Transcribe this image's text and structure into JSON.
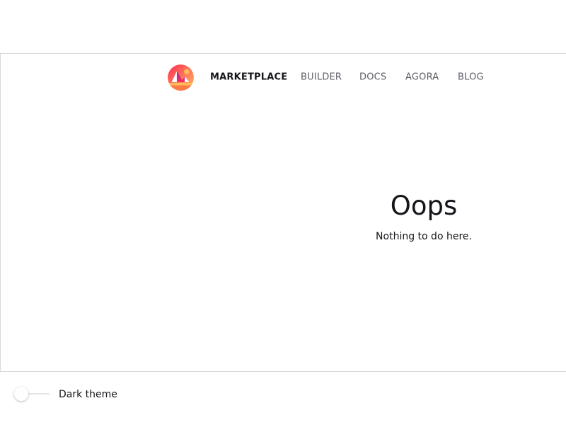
{
  "header": {
    "logo_icon": "decentraland-logo-icon",
    "nav": {
      "marketplace": "MARKETPLACE",
      "builder": "BUILDER",
      "docs": "DOCS",
      "agora": "AGORA",
      "blog": "BLOG"
    },
    "active_item": "MARKETPLACE"
  },
  "main": {
    "title": "Oops",
    "message": "Nothing to do here."
  },
  "footer": {
    "theme_toggle": {
      "label": "Dark theme",
      "checked": false
    }
  },
  "colors": {
    "text": "#16141a",
    "muted_text": "#5f5b66",
    "border": "#d9d9d9",
    "logo_red": "#ff2d55",
    "logo_orange": "#ffbc5b"
  }
}
